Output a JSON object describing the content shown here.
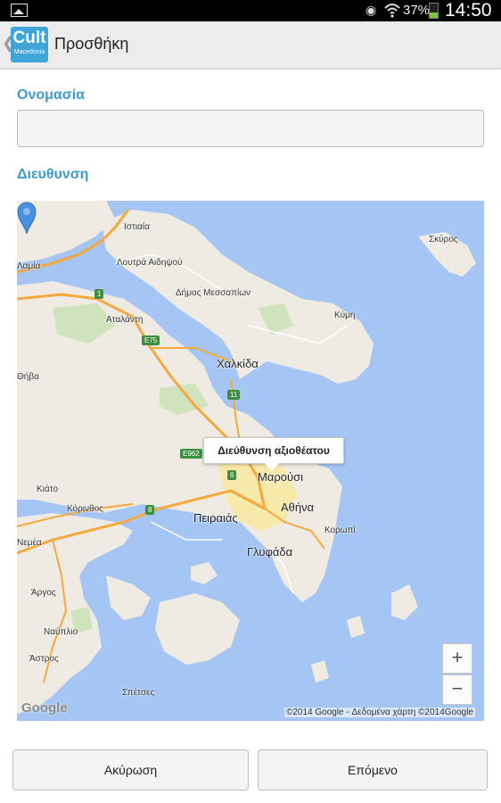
{
  "status_bar": {
    "battery": "37%",
    "time": "14:50"
  },
  "action_bar": {
    "logo_main": "Cult",
    "logo_sub": "Macedonia",
    "title": "Προσθήκη"
  },
  "form": {
    "name_label": "Ονομασία",
    "name_value": "",
    "address_label": "Διευθυνση"
  },
  "map": {
    "info_window": "Διεύθυνση αξιοθέατου",
    "zoom_in": "+",
    "zoom_out": "−",
    "logo": "Google",
    "copyright": "©2014 Google - Δεδομένα χάρτη ©2014Google",
    "labels": {
      "skyros": "Σκύρος",
      "istiaia": "Ιστιαία",
      "loutra": "Λουτρά Αιδηψού",
      "mesaria": "Δήμος Μεσσαπίων",
      "lamia": "Λαμία",
      "kymi": "Κύμη",
      "atalanti": "Αταλάντη",
      "chalkida": "Χαλκίδα",
      "theva": "Θήβα",
      "marousi": "Μαρούσι",
      "athina": "Αθήνα",
      "kiato": "Κιάτο",
      "korinthos": "Κόρινθος",
      "peiraias": "Πειραιάς",
      "koropi": "Κορωπί",
      "glyfada": "Γλυφάδα",
      "nemea": "Νεμέα",
      "argos": "Άργος",
      "nafplio": "Ναύπλιο",
      "astros": "Άστρος",
      "spetses": "Σπέτσες"
    },
    "roads": {
      "r1": "1",
      "e75": "E75",
      "r11": "11",
      "e962": "E962",
      "r6": "6",
      "r8": "8"
    }
  },
  "buttons": {
    "cancel": "Ακύρωση",
    "next": "Επόμενο"
  },
  "colors": {
    "accent": "#3d9bc9",
    "sea": "#a5c6f4",
    "land": "#efebe2",
    "motorway": "#f4a83d"
  }
}
